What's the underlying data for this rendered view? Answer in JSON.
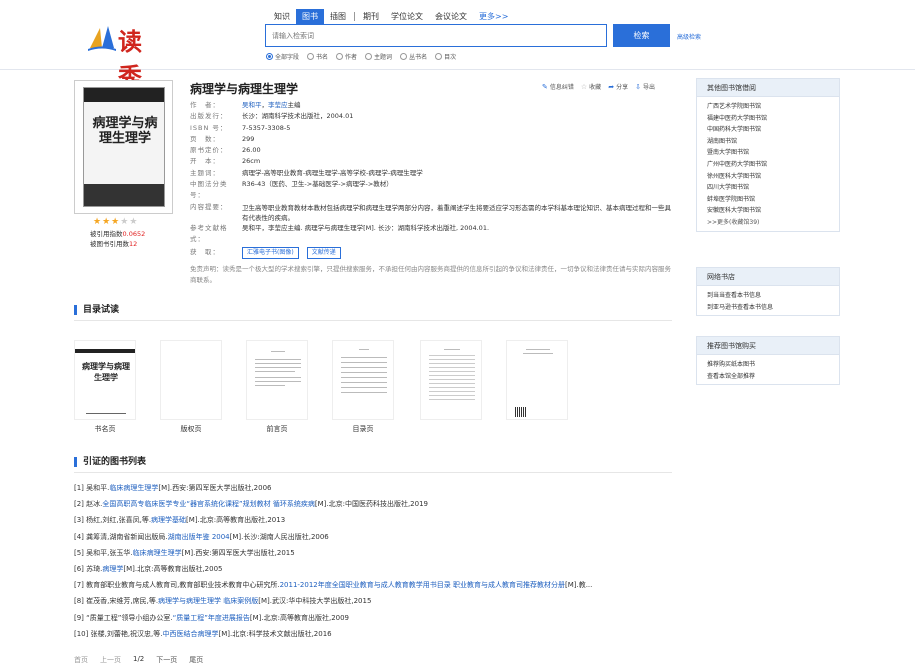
{
  "header": {
    "logo_text": "读秀",
    "nav_tabs": [
      {
        "label": "知识",
        "active": false
      },
      {
        "label": "图书",
        "active": true
      },
      {
        "label": "插图",
        "active": false
      },
      {
        "label": "期刊",
        "active": false
      },
      {
        "label": "学位论文",
        "active": false
      },
      {
        "label": "会议论文",
        "active": false
      }
    ],
    "nav_more": "更多>>",
    "search_placeholder": "请输入检索词",
    "search_button": "检索",
    "advanced_link": "高级检索",
    "search_scopes": [
      {
        "label": "全部字段",
        "checked": true
      },
      {
        "label": "书名",
        "checked": false
      },
      {
        "label": "作者",
        "checked": false
      },
      {
        "label": "主题词",
        "checked": false
      },
      {
        "label": "丛书名",
        "checked": false
      },
      {
        "label": "目次",
        "checked": false
      }
    ]
  },
  "book": {
    "cover_title": "病理学与病理生理学",
    "title": "病理学与病理生理学",
    "rating": 3,
    "stats": {
      "view_label": "被引用指数",
      "view_value": "0.0652",
      "cite_label": "被图书引用数",
      "cite_value": "12"
    },
    "actions": [
      "信息纠错",
      "收藏",
      "分享",
      "导出"
    ],
    "fields": {
      "author_label": "作　者：",
      "authors": [
        "吴和平",
        "李莹应"
      ],
      "author_suffix": "主编",
      "publisher_label": "出版发行：",
      "publisher": "长沙：湖南科学技术出版社，2004.01",
      "isbn_label": "ISBN 号：",
      "isbn": "7-5357-3308-5",
      "pages_label": "页　数：",
      "pages": "299",
      "price_label": "原书定价：",
      "price": "26.00",
      "size_label": "开　本：",
      "size": "26cm",
      "subject_label": "主题词：",
      "subject": "病理学-高等职业教育-病理生理学-高等学校-病理学-病理生理学",
      "clc_label": "中图法分类号：",
      "clc": "R36-43（医药、卫生->基础医学->病理学->教材）",
      "summary_label": "内容提要：",
      "summary": "卫生高等职业教育教材本教材包括病理学和病理生理学两部分内容，着重阐述学生将要适应学习形态需的本学科基本理论知识、基本病理过程和一些具有代表性的疾病。",
      "ref_format_label": "参考文献格式：",
      "ref_format": "吴和平，李莹应主编. 病理学与病理生理学[M]. 长沙：湖南科学技术出版社, 2004.01.",
      "get_label": "获　取：",
      "get_buttons": [
        "汇雅电子书(图像)",
        "文献传递"
      ]
    },
    "disclaimer": "免责声明：读秀是一个极大型的学术搜索引擎，只提供搜索服务，不承担任何由内容服务商提供的信息所引起的争议和法律责任，一切争议和法律责任请与实际内容服务商联系。"
  },
  "toc_section": {
    "title": "目录试读",
    "previews": [
      {
        "label": "书名页"
      },
      {
        "label": "版权页"
      },
      {
        "label": "前言页"
      },
      {
        "label": "目录页"
      },
      {
        "label": ""
      },
      {
        "label": ""
      }
    ]
  },
  "refs_section": {
    "title": "引证的图书列表",
    "items": [
      {
        "prefix": "[1] 吴和平.",
        "link": "临床病理生理学",
        "suffix": "[M].西安:第四军医大学出版社,2006"
      },
      {
        "prefix": "[2] 赵冰.",
        "link": "全国高职高专临床医学专业“器官系统化课程”规划教材 循环系统疾病",
        "suffix": "[M].北京:中国医药科技出版社,2019"
      },
      {
        "prefix": "[3] 杨红,刘红,张喜凤,等.",
        "link": "病理学基础",
        "suffix": "[M].北京:高等教育出版社,2013"
      },
      {
        "prefix": "[4] 龚筹清,湖南省新闻出版局.",
        "link": "湖南出版年鉴 2004",
        "suffix": "[M].长沙:湖南人民出版社,2006"
      },
      {
        "prefix": "[5] 吴和平,张玉华.",
        "link": "临床病理生理学",
        "suffix": "[M].西安:第四军医大学出版社,2015"
      },
      {
        "prefix": "[6] 苏琦.",
        "link": "病理学",
        "suffix": "[M].北京:高等教育出版社,2005"
      },
      {
        "prefix": "[7] 教育部职业教育与成人教育司,教育部职业技术教育中心研究所.",
        "link": "2011-2012年度全国职业教育与成人教育教学用书目录 职业教育与成人教育司推荐教材分册",
        "suffix": "[M].教..."
      },
      {
        "prefix": "[8] 崔茂香,宋维芳,席民,等.",
        "link": "病理学与病理生理学 临床案例版",
        "suffix": "[M].武汉:华中科技大学出版社,2015"
      },
      {
        "prefix": "[9] “质量工程”领导小组办公室.",
        "link": "“质量工程”年度进展报告",
        "suffix": "[M].北京:高等教育出版社,2009"
      },
      {
        "prefix": "[10] 张楼,刘蕾艳,祝汉忠,等.",
        "link": "中西医结合病理学",
        "suffix": "[M].北京:科学技术文献出版社,2016"
      }
    ]
  },
  "pager": {
    "first": "首页",
    "prev": "上一页",
    "current": "1/2",
    "next": "下一页",
    "last": "尾页"
  },
  "sidebar": {
    "libraries": {
      "title": "其他图书馆借阅",
      "items": [
        "广西艺术学院图书馆",
        "福建中医药大学图书馆",
        "中国药科大学图书馆",
        "湖南图书馆",
        "暨南大学图书馆",
        "广州中医药大学图书馆",
        "徐州医科大学图书馆",
        "四川大学图书馆",
        "蚌埠医学院图书馆",
        "安徽医科大学图书馆"
      ],
      "more": ">>更多(收藏馆39)"
    },
    "online": {
      "title": "网络书店",
      "items": [
        "到当当查看本书信息",
        "到亚马逊书查看本书信息"
      ]
    },
    "recommend": {
      "title": "推荐图书馆购买",
      "items": [
        "推荐购买纸本图书",
        "查看本馆全部推荐"
      ]
    }
  }
}
